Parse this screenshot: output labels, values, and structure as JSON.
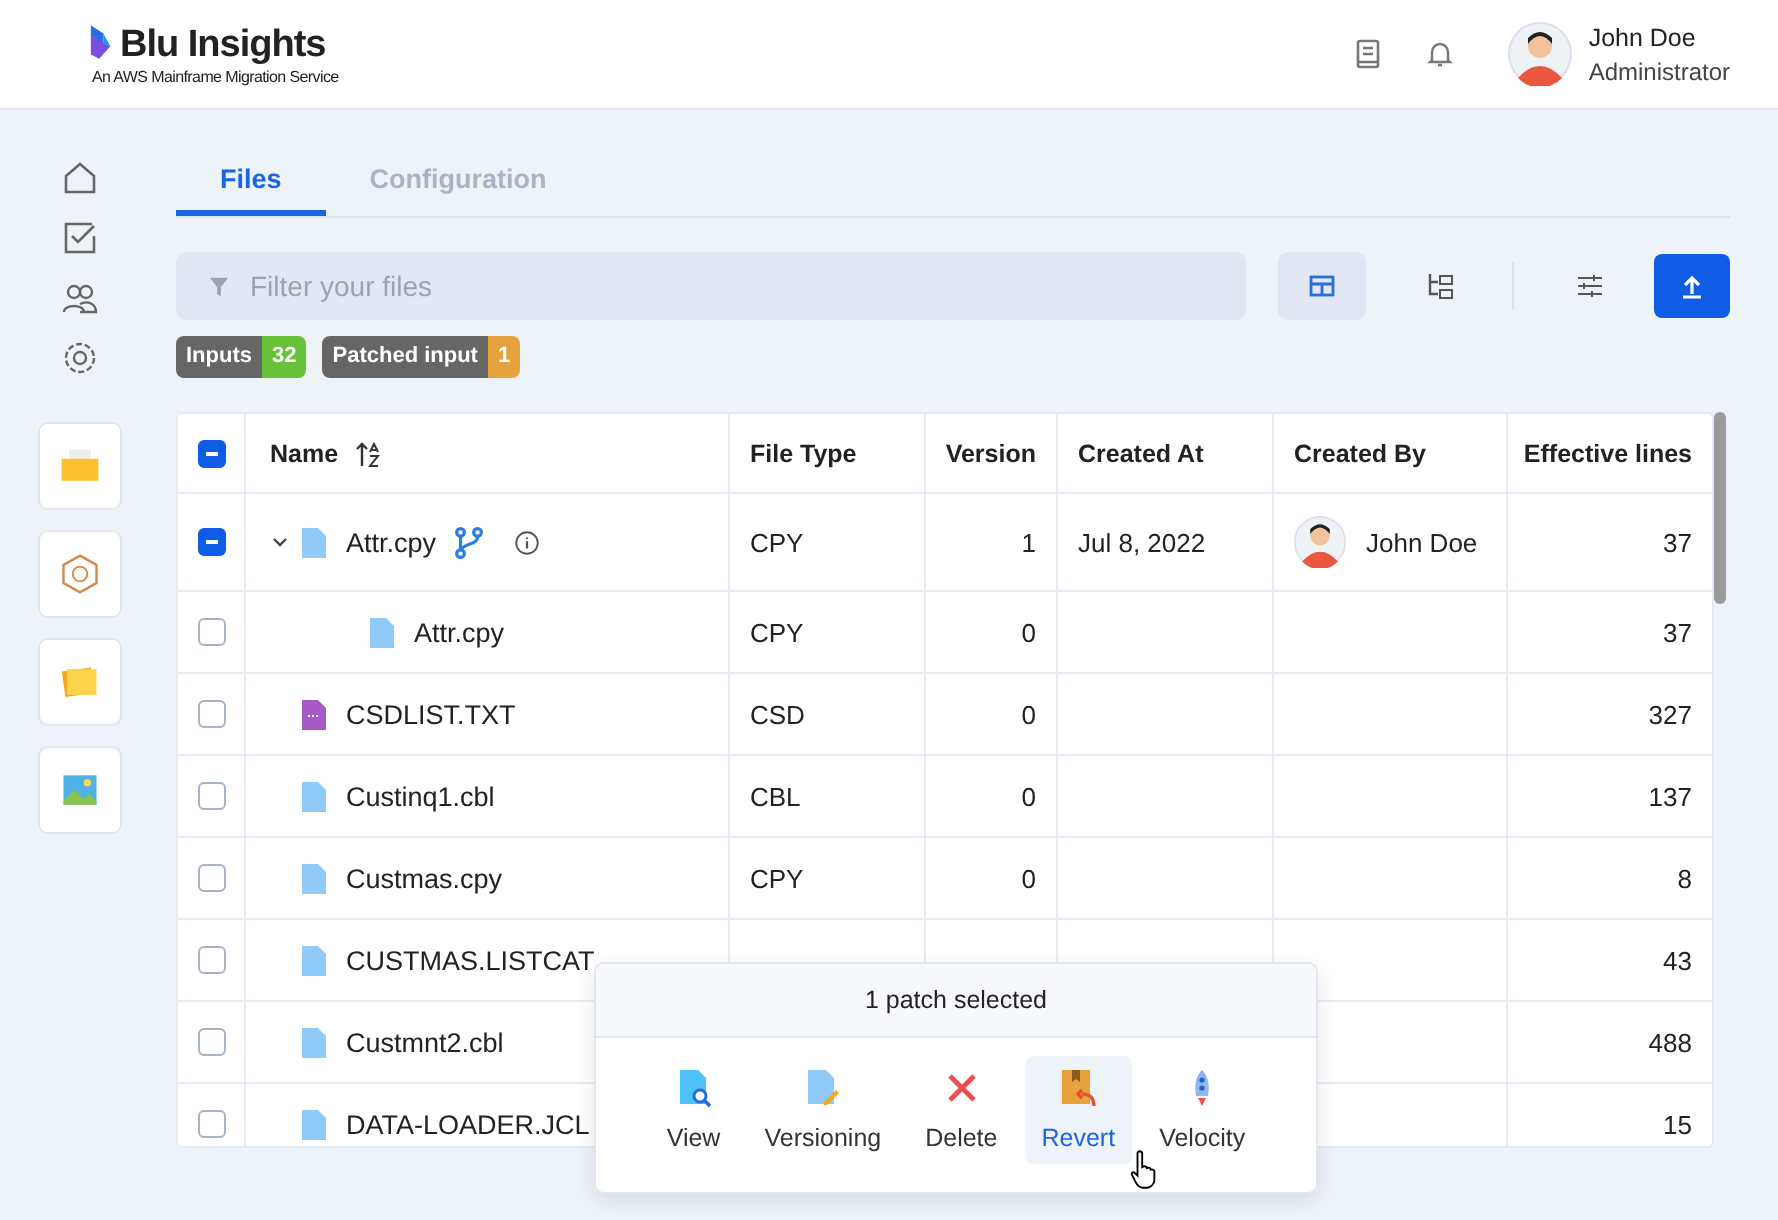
{
  "header": {
    "brand": "Blu Insights",
    "tagline": "An AWS Mainframe Migration Service",
    "user": {
      "name": "John Doe",
      "role": "Administrator"
    }
  },
  "tabs": [
    {
      "label": "Files",
      "selected": true
    },
    {
      "label": "Configuration",
      "selected": false
    }
  ],
  "filter": {
    "placeholder": "Filter your files"
  },
  "view_buttons": [
    {
      "kind": "table",
      "selected": true
    },
    {
      "kind": "tree",
      "selected": false
    }
  ],
  "badges": [
    {
      "label": "Inputs",
      "count": "32",
      "color": "#67c23a"
    },
    {
      "label": "Patched input",
      "count": "1",
      "color": "#e6a23c"
    }
  ],
  "table": {
    "header_checked": true,
    "columns": [
      "Name",
      "File Type",
      "Version",
      "Created At",
      "Created By",
      "Effective lines"
    ],
    "rows": [
      {
        "name": "Attr.cpy",
        "kind": "file",
        "checked": true,
        "expanded": true,
        "patched": true,
        "type": "CPY",
        "version": "1",
        "created_at": "Jul 8, 2022",
        "created_by": "John Doe",
        "lines": "37",
        "children": [
          {
            "name": "Attr.cpy",
            "kind": "file",
            "checked": false,
            "type": "CPY",
            "version": "0",
            "lines": "37"
          }
        ]
      },
      {
        "name": "CSDLIST.TXT",
        "kind": "csd",
        "checked": false,
        "type": "CSD",
        "version": "0",
        "lines": "327"
      },
      {
        "name": "Custinq1.cbl",
        "kind": "file",
        "checked": false,
        "type": "CBL",
        "version": "0",
        "lines": "137"
      },
      {
        "name": "Custmas.cpy",
        "kind": "file",
        "checked": false,
        "type": "CPY",
        "version": "0",
        "lines": "8"
      },
      {
        "name": "CUSTMAS.LISTCAT",
        "kind": "file",
        "checked": false,
        "lines": "43"
      },
      {
        "name": "Custmnt2.cbl",
        "kind": "file",
        "checked": false,
        "lines": "488"
      },
      {
        "name": "DATA-LOADER.JCL",
        "kind": "file",
        "checked": false,
        "lines": "15"
      }
    ]
  },
  "popup": {
    "title": "1 patch selected",
    "actions": [
      {
        "label": "View",
        "kind": "view",
        "selected": false
      },
      {
        "label": "Versioning",
        "kind": "versioning",
        "selected": false
      },
      {
        "label": "Delete",
        "kind": "delete",
        "selected": false
      },
      {
        "label": "Revert",
        "kind": "revert",
        "selected": true
      },
      {
        "label": "Velocity",
        "kind": "velocity",
        "selected": false
      }
    ]
  }
}
